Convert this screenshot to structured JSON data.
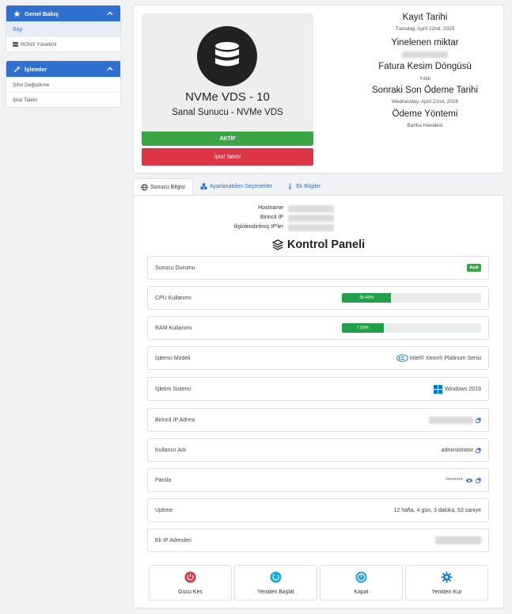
{
  "sidebar": {
    "overview": {
      "title": "Genel Bakış",
      "items": [
        "Bilgi",
        "RDNS Yönetimi"
      ]
    },
    "actions": {
      "title": "İşlemler",
      "items": [
        "Şifre Değiştirme",
        "İptal Talebi"
      ]
    }
  },
  "product": {
    "name": "NVMe VDS - 10",
    "group": "Sanal Sunucu - NVMe VDS",
    "status": "AKTİF",
    "cancel_label": "İptal Talebi"
  },
  "billing": {
    "reg_date_label": "Kayıt Tarihi",
    "reg_date": "Tuesday, April 22nd, 2025",
    "recurring_label": "Yinelenen miktar",
    "cycle_label": "Fatura Kesim Döngüsü",
    "cycle": "Yıllık",
    "next_due_label": "Sonraki Son Ödeme Tarihi",
    "next_due": "Wednesday, April 22nd, 2026",
    "payment_label": "Ödeme Yöntemi",
    "payment": "Banka Havalesi"
  },
  "tabs": [
    "Sunucu Bilgisi",
    "Ayarlanabilen Seçenekler",
    "Ek Bilgiler"
  ],
  "server_info": {
    "hostname_label": "Hostname",
    "primary_ip_label": "Birincil IP",
    "assigned_ips_label": "İlişkilendirilmiş IP'ler"
  },
  "control_panel": {
    "title": "Kontrol Paneli",
    "rows": {
      "status_label": "Sunucu Durumu",
      "status_value": "Açık",
      "cpu_label": "CPU Kullanımı",
      "cpu_text": "35.40%",
      "cpu_percent": 35.4,
      "ram_label": "RAM Kullanımı",
      "ram_text": "7.00%",
      "ram_percent": 7.0,
      "processor_label": "İşlemci Modeli",
      "processor_value": "Intel® Xeon® Platinum Serisi",
      "os_label": "İşletim Sistemi",
      "os_value": "Windows 2019",
      "primary_ip_label": "Birincil IP Adresi",
      "username_label": "Kullanıcı Adı",
      "username_value": "administrator",
      "password_label": "Parola",
      "password_value": "********",
      "uptime_label": "Uptime",
      "uptime_value": "12 hafta, 4 gün, 3 dakika, 53 saniye",
      "extra_ips_label": "Ek IP Adresleri"
    },
    "actions": [
      "Gücü Kes",
      "Yeniden Başlat",
      "Kapat",
      "Yeniden Kur"
    ]
  },
  "colors": {
    "primary": "#2f6fd0",
    "success": "#3aa545",
    "danger": "#dc3545"
  }
}
